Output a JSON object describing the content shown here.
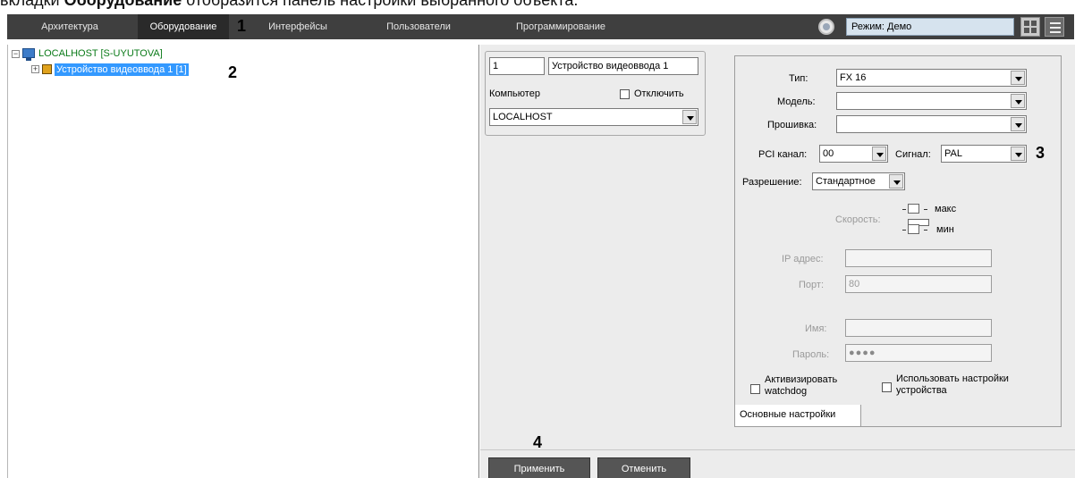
{
  "caption": {
    "prefix": "вкладки ",
    "bold": "Оборудование",
    "suffix": " отобразится панель настройки выбранного объекта."
  },
  "nav": {
    "tabs": [
      {
        "label": "Архитектура",
        "active": false
      },
      {
        "label": "Оборудование",
        "active": true
      },
      {
        "label": "Интерфейсы",
        "active": false
      },
      {
        "label": "Пользователи",
        "active": false
      },
      {
        "label": "Программирование",
        "active": false
      }
    ],
    "mode_field": "Режим: Демо"
  },
  "callouts": {
    "one": "1",
    "two": "2",
    "three": "3",
    "four": "4"
  },
  "tree": {
    "root_label": "LOCALHOST [S-UYUTOVA]",
    "child_label": "Устройство видеоввода 1 [1]"
  },
  "object": {
    "id": "1",
    "name": "Устройство видеоввода 1",
    "computer_label": "Компьютер",
    "disable_label": "Отключить",
    "computer_value": "LOCALHOST"
  },
  "settings": {
    "type_label": "Тип:",
    "type_value": "FX 16",
    "model_label": "Модель:",
    "model_value": "",
    "firmware_label": "Прошивка:",
    "firmware_value": "",
    "pci_label": "PCI канал:",
    "pci_value": "00",
    "signal_label": "Сигнал:",
    "signal_value": "PAL",
    "resolution_label": "Разрешение:",
    "resolution_value": "Стандартное",
    "speed_label": "Скорость:",
    "speed_max": "макс",
    "speed_min": "мин",
    "ip_label": "IP адрес:",
    "ip_value": "",
    "port_label": "Порт:",
    "port_value": "80",
    "name_label": "Имя:",
    "name_value": "",
    "password_label": "Пароль:",
    "password_value": "●●●●",
    "watchdog_label_1": "Активизировать",
    "watchdog_label_2": "watchdog",
    "use_settings_label_1": "Использовать настройки",
    "use_settings_label_2": "устройства",
    "tab_label": "Основные настройки"
  },
  "buttons": {
    "apply": "Применить",
    "cancel": "Отменить"
  }
}
